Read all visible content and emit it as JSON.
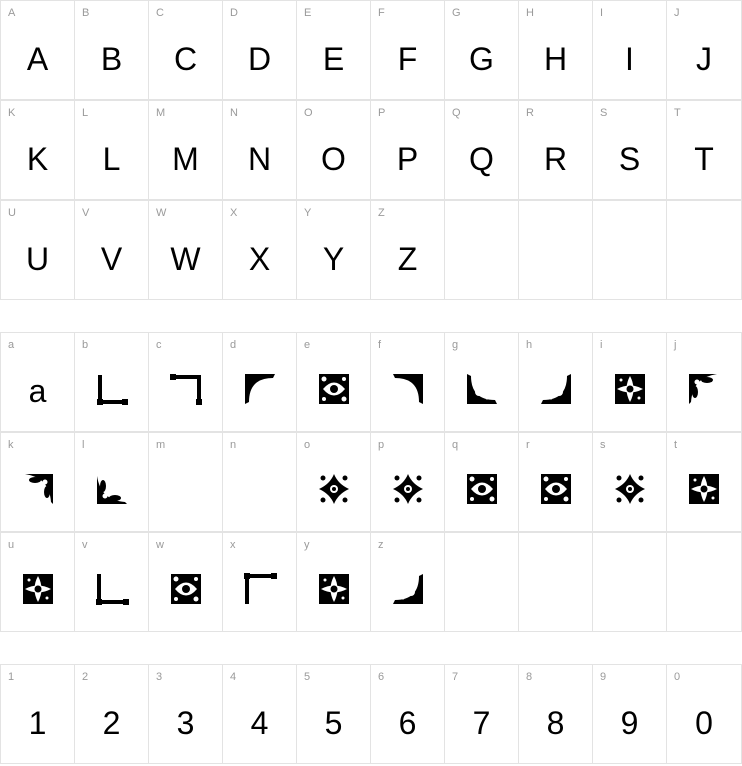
{
  "uppercase": [
    {
      "label": "A",
      "glyph": "A"
    },
    {
      "label": "B",
      "glyph": "B"
    },
    {
      "label": "C",
      "glyph": "C"
    },
    {
      "label": "D",
      "glyph": "D"
    },
    {
      "label": "E",
      "glyph": "E"
    },
    {
      "label": "F",
      "glyph": "F"
    },
    {
      "label": "G",
      "glyph": "G"
    },
    {
      "label": "H",
      "glyph": "H"
    },
    {
      "label": "I",
      "glyph": "I"
    },
    {
      "label": "J",
      "glyph": "J"
    },
    {
      "label": "K",
      "glyph": "K"
    },
    {
      "label": "L",
      "glyph": "L"
    },
    {
      "label": "M",
      "glyph": "M"
    },
    {
      "label": "N",
      "glyph": "N"
    },
    {
      "label": "O",
      "glyph": "O"
    },
    {
      "label": "P",
      "glyph": "P"
    },
    {
      "label": "Q",
      "glyph": "Q"
    },
    {
      "label": "R",
      "glyph": "R"
    },
    {
      "label": "S",
      "glyph": "S"
    },
    {
      "label": "T",
      "glyph": "T"
    },
    {
      "label": "U",
      "glyph": "U"
    },
    {
      "label": "V",
      "glyph": "V"
    },
    {
      "label": "W",
      "glyph": "W"
    },
    {
      "label": "X",
      "glyph": "X"
    },
    {
      "label": "Y",
      "glyph": "Y"
    },
    {
      "label": "Z",
      "glyph": "Z"
    }
  ],
  "lowercase": [
    {
      "label": "a",
      "glyph": "a",
      "ornament": ""
    },
    {
      "label": "b",
      "glyph": "",
      "ornament": "bracket-bottom-left"
    },
    {
      "label": "c",
      "glyph": "",
      "ornament": "bracket-top-right"
    },
    {
      "label": "d",
      "glyph": "",
      "ornament": "floral-corner-top-left"
    },
    {
      "label": "e",
      "glyph": "",
      "ornament": "floral-tile"
    },
    {
      "label": "f",
      "glyph": "",
      "ornament": "floral-corner-top-right"
    },
    {
      "label": "g",
      "glyph": "",
      "ornament": "floral-corner-bottom-left"
    },
    {
      "label": "h",
      "glyph": "",
      "ornament": "floral-corner-bottom-right"
    },
    {
      "label": "i",
      "glyph": "",
      "ornament": "floral-tile-dense"
    },
    {
      "label": "j",
      "glyph": "",
      "ornament": "floral-corner-top-left-leaf"
    },
    {
      "label": "k",
      "glyph": "",
      "ornament": "floral-corner-top-right-leaf"
    },
    {
      "label": "l",
      "glyph": "",
      "ornament": "floral-corner-bottom-left-leaf"
    },
    {
      "label": "m",
      "glyph": "",
      "ornament": ""
    },
    {
      "label": "n",
      "glyph": "",
      "ornament": ""
    },
    {
      "label": "o",
      "glyph": "",
      "ornament": "floral-cross"
    },
    {
      "label": "p",
      "glyph": "",
      "ornament": "floral-cross"
    },
    {
      "label": "q",
      "glyph": "",
      "ornament": "floral-tile"
    },
    {
      "label": "r",
      "glyph": "",
      "ornament": "floral-tile"
    },
    {
      "label": "s",
      "glyph": "",
      "ornament": "floral-cross"
    },
    {
      "label": "t",
      "glyph": "",
      "ornament": "floral-tile-dense"
    },
    {
      "label": "u",
      "glyph": "",
      "ornament": "floral-tile-dense"
    },
    {
      "label": "v",
      "glyph": "",
      "ornament": "bracket-left-bottom"
    },
    {
      "label": "w",
      "glyph": "",
      "ornament": "floral-tile"
    },
    {
      "label": "x",
      "glyph": "",
      "ornament": "bracket-top-left"
    },
    {
      "label": "y",
      "glyph": "",
      "ornament": "floral-tile-dense"
    },
    {
      "label": "z",
      "glyph": "",
      "ornament": "floral-corner-bottom-right"
    }
  ],
  "digits": [
    {
      "label": "1",
      "glyph": "1"
    },
    {
      "label": "2",
      "glyph": "2"
    },
    {
      "label": "3",
      "glyph": "3"
    },
    {
      "label": "4",
      "glyph": "4"
    },
    {
      "label": "5",
      "glyph": "5"
    },
    {
      "label": "6",
      "glyph": "6"
    },
    {
      "label": "7",
      "glyph": "7"
    },
    {
      "label": "8",
      "glyph": "8"
    },
    {
      "label": "9",
      "glyph": "9"
    },
    {
      "label": "0",
      "glyph": "0"
    }
  ]
}
